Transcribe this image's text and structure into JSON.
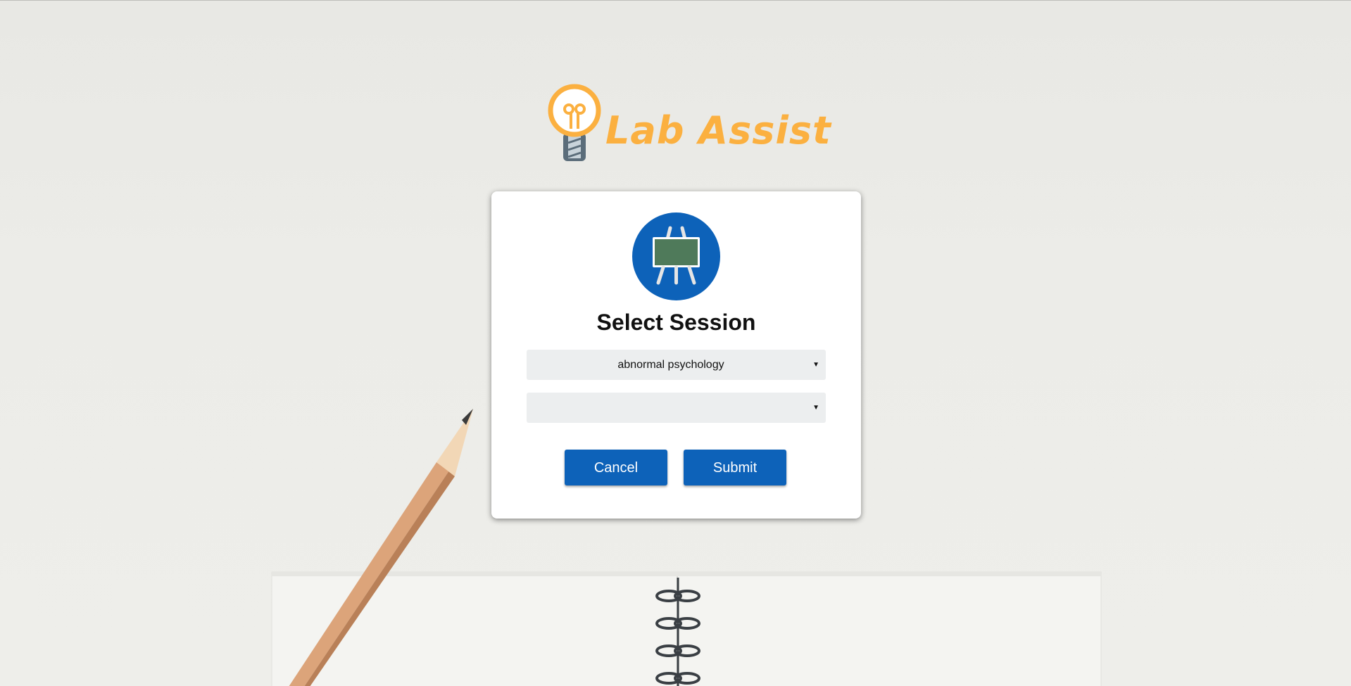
{
  "brand": {
    "name": "Lab Assist",
    "color": "#fbb040",
    "icon": "lightbulb-icon"
  },
  "dialog": {
    "icon": "presentation-easel-icon",
    "icon_bg_color": "#0d62b9",
    "title": "Select Session",
    "course_select": {
      "value": "abnormal psychology",
      "icon": "dropdown-arrow-icon"
    },
    "session_select": {
      "value": "",
      "icon": "dropdown-arrow-icon"
    },
    "cancel_label": "Cancel",
    "submit_label": "Submit",
    "button_color": "#0d62b9"
  },
  "background": {
    "decor": [
      "pencil",
      "spiral-notebook"
    ]
  }
}
